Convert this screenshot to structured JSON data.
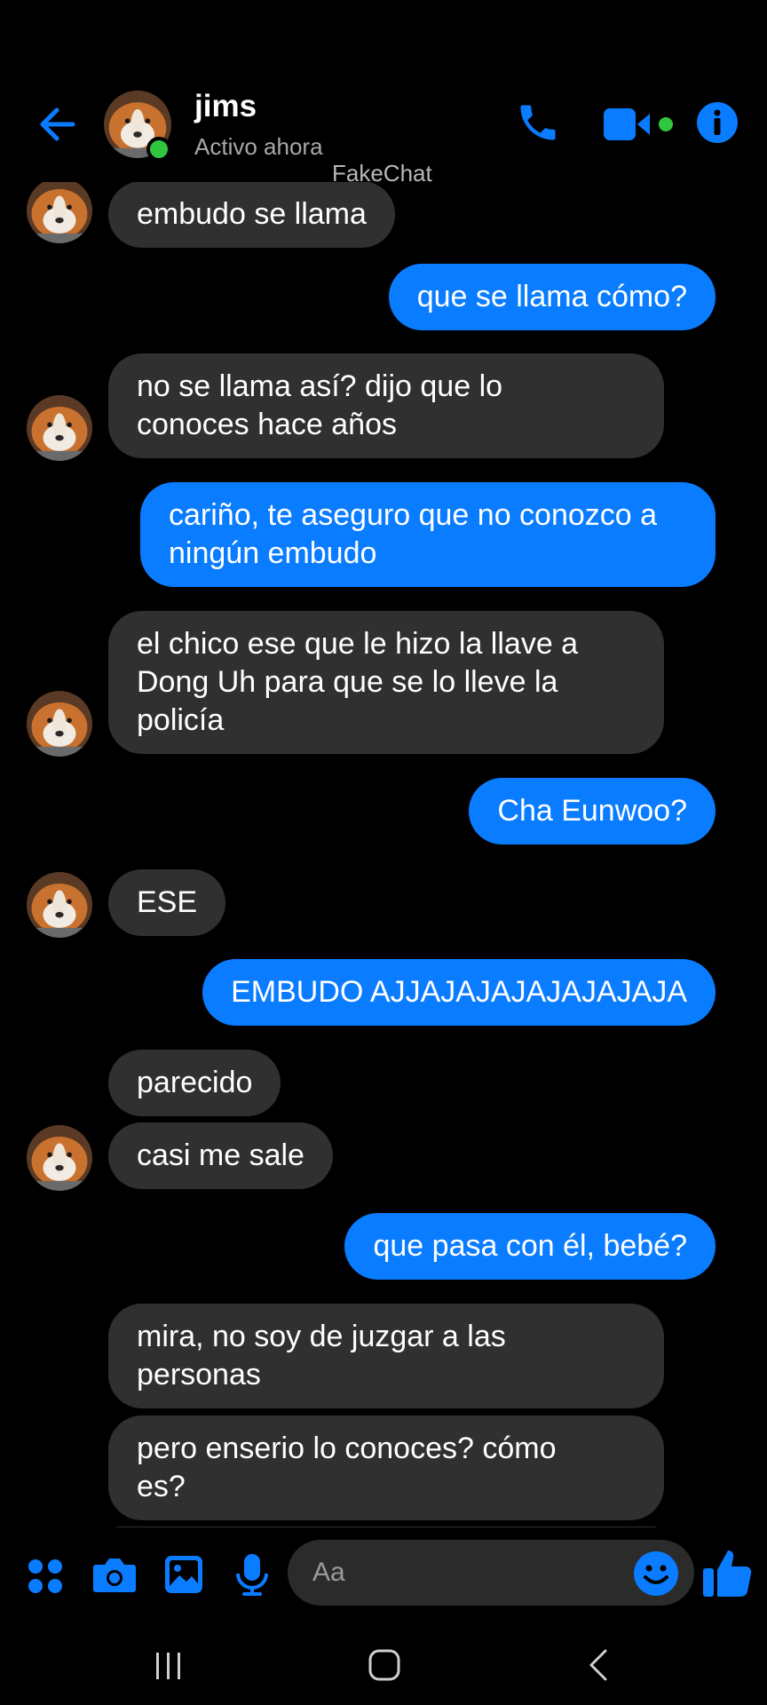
{
  "header": {
    "contact_name": "jims",
    "status": "Activo ahora",
    "watermark": "FakeChat",
    "accent_color": "#0a7cff"
  },
  "messages": [
    {
      "dir": "in",
      "text": "embudo se llama",
      "avatar": true
    },
    {
      "dir": "out",
      "text": "que se llama cómo?"
    },
    {
      "dir": "in",
      "text": "no se llama así? dijo que lo\nconoces hace años",
      "avatar": true
    },
    {
      "dir": "out",
      "text": "cariño, te aseguro que no conozco a\nningún embudo"
    },
    {
      "dir": "in",
      "text": "el chico ese que le hizo la llave a\nDong Uh para que se lo lleve la\npolicía",
      "avatar": true
    },
    {
      "dir": "out",
      "text": "Cha Eunwoo?"
    },
    {
      "dir": "in",
      "text": "ESE",
      "avatar": true
    },
    {
      "dir": "out",
      "text": "EMBUDO AJJAJAJAJAJAJAJAJA"
    },
    {
      "dir": "in",
      "text": "parecido"
    },
    {
      "dir": "in",
      "text": "casi me sale",
      "avatar": true
    },
    {
      "dir": "out",
      "text": "que pasa con él, bebé?"
    },
    {
      "dir": "in",
      "text": "mira, no soy de juzgar a las\npersonas"
    },
    {
      "dir": "in",
      "text": "pero enserio lo conoces? cómo\nes?"
    }
  ],
  "composer": {
    "placeholder": "Aa"
  },
  "icons": {
    "back": "arrow-left-icon",
    "call": "phone-icon",
    "video": "video-camera-icon",
    "info": "info-icon",
    "apps": "apps-grid-icon",
    "camera": "camera-icon",
    "gallery": "image-icon",
    "mic": "microphone-icon",
    "emoji": "smiley-icon",
    "like": "thumbs-up-icon"
  }
}
